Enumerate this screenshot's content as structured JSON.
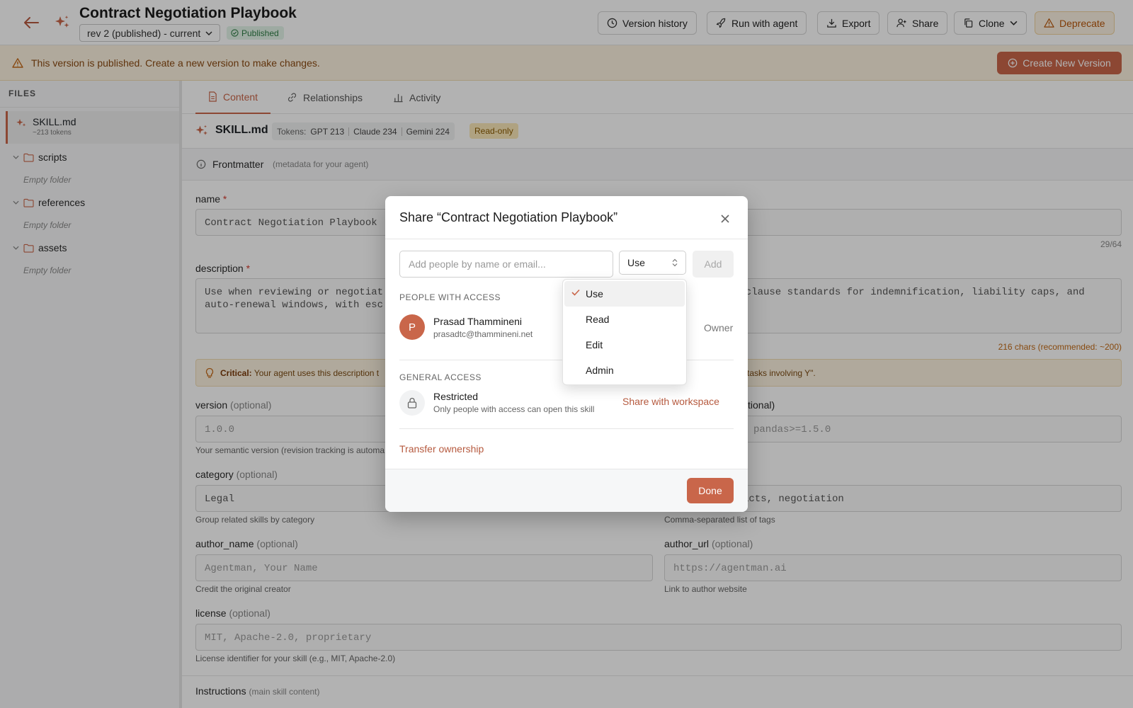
{
  "header": {
    "title": "Contract Negotiation Playbook",
    "revision": "rev 2 (published) - current",
    "status": "Published",
    "buttons": {
      "version_history": "Version history",
      "run_with_agent": "Run with agent",
      "export": "Export",
      "share": "Share",
      "clone": "Clone",
      "deprecate": "Deprecate"
    }
  },
  "banner": {
    "text": "This version is published. Create a new version to make changes.",
    "button": "Create New Version"
  },
  "sidebar": {
    "label": "FILES",
    "active_file": {
      "name": "SKILL.md",
      "tokens": "~213 tokens"
    },
    "folders": [
      {
        "name": "scripts",
        "empty": "Empty folder"
      },
      {
        "name": "references",
        "empty": "Empty folder"
      },
      {
        "name": "assets",
        "empty": "Empty folder"
      }
    ]
  },
  "tabs": [
    {
      "label": "Content"
    },
    {
      "label": "Relationships"
    },
    {
      "label": "Activity"
    }
  ],
  "filebar": {
    "name": "SKILL.md",
    "tokens_label": "Tokens:",
    "gpt": "GPT 213",
    "claude": "Claude 234",
    "gemini": "Gemini 224",
    "readonly": "Read-only"
  },
  "frontmatter": {
    "title": "Frontmatter",
    "hint": "(metadata for your agent)"
  },
  "form": {
    "name": {
      "label": "name",
      "value": "Contract Negotiation Playbook",
      "counter": "29/64"
    },
    "description": {
      "label": "description",
      "value_left": "Use when reviewing or negotiat",
      "value_left2": "auto-renewal windows, with esc",
      "value_right": "y-clause standards for indemnification, liability caps, and",
      "counter": "216 chars (recommended: ~200)"
    },
    "critical": {
      "label": "Critical:",
      "text": "Your agent uses this description t",
      "tail": "tasks involving Y\"."
    },
    "version": {
      "label": "version",
      "optional": "(optional)",
      "placeholder": "1.0.0",
      "help": "Your semantic version (revision tracking is automa"
    },
    "dependencies": {
      "label_tail": "tional)",
      "placeholder": "pandas>=1.5.0"
    },
    "category": {
      "label": "category",
      "optional": "(optional)",
      "value": "Legal",
      "help": "Group related skills by category"
    },
    "tags": {
      "value": "acts, negotiation",
      "help": "Comma-separated list of tags"
    },
    "author_name": {
      "label": "author_name",
      "optional": "(optional)",
      "placeholder": "Agentman, Your Name",
      "help": "Credit the original creator"
    },
    "author_url": {
      "label": "author_url",
      "optional": "(optional)",
      "placeholder": "https://agentman.ai",
      "help": "Link to author website"
    },
    "license": {
      "label": "license",
      "optional": "(optional)",
      "placeholder": "MIT, Apache-2.0, proprietary",
      "help": "License identifier for your skill (e.g., MIT, Apache-2.0)"
    },
    "instructions": {
      "label": "Instructions",
      "hint": "(main skill content)"
    }
  },
  "modal": {
    "title": "Share “Contract Negotiation Playbook”",
    "input_placeholder": "Add people by name or email...",
    "role": "Use",
    "add": "Add",
    "people_label": "PEOPLE WITH ACCESS",
    "person": {
      "initial": "P",
      "name": "Prasad Thammineni",
      "email": "prasadtc@thammineni.net",
      "role": "Owner"
    },
    "general_label": "GENERAL ACCESS",
    "access": {
      "title": "Restricted",
      "subtitle": "Only people with access can open this skill",
      "share_workspace": "Share with workspace"
    },
    "transfer": "Transfer ownership",
    "done": "Done"
  },
  "dropdown": {
    "options": [
      "Use",
      "Read",
      "Edit",
      "Admin"
    ],
    "selected": "Use"
  },
  "colors": {
    "accent": "#c9664a",
    "published_bg": "#e3f4e8",
    "warning_bg": "#fdf3e0"
  }
}
